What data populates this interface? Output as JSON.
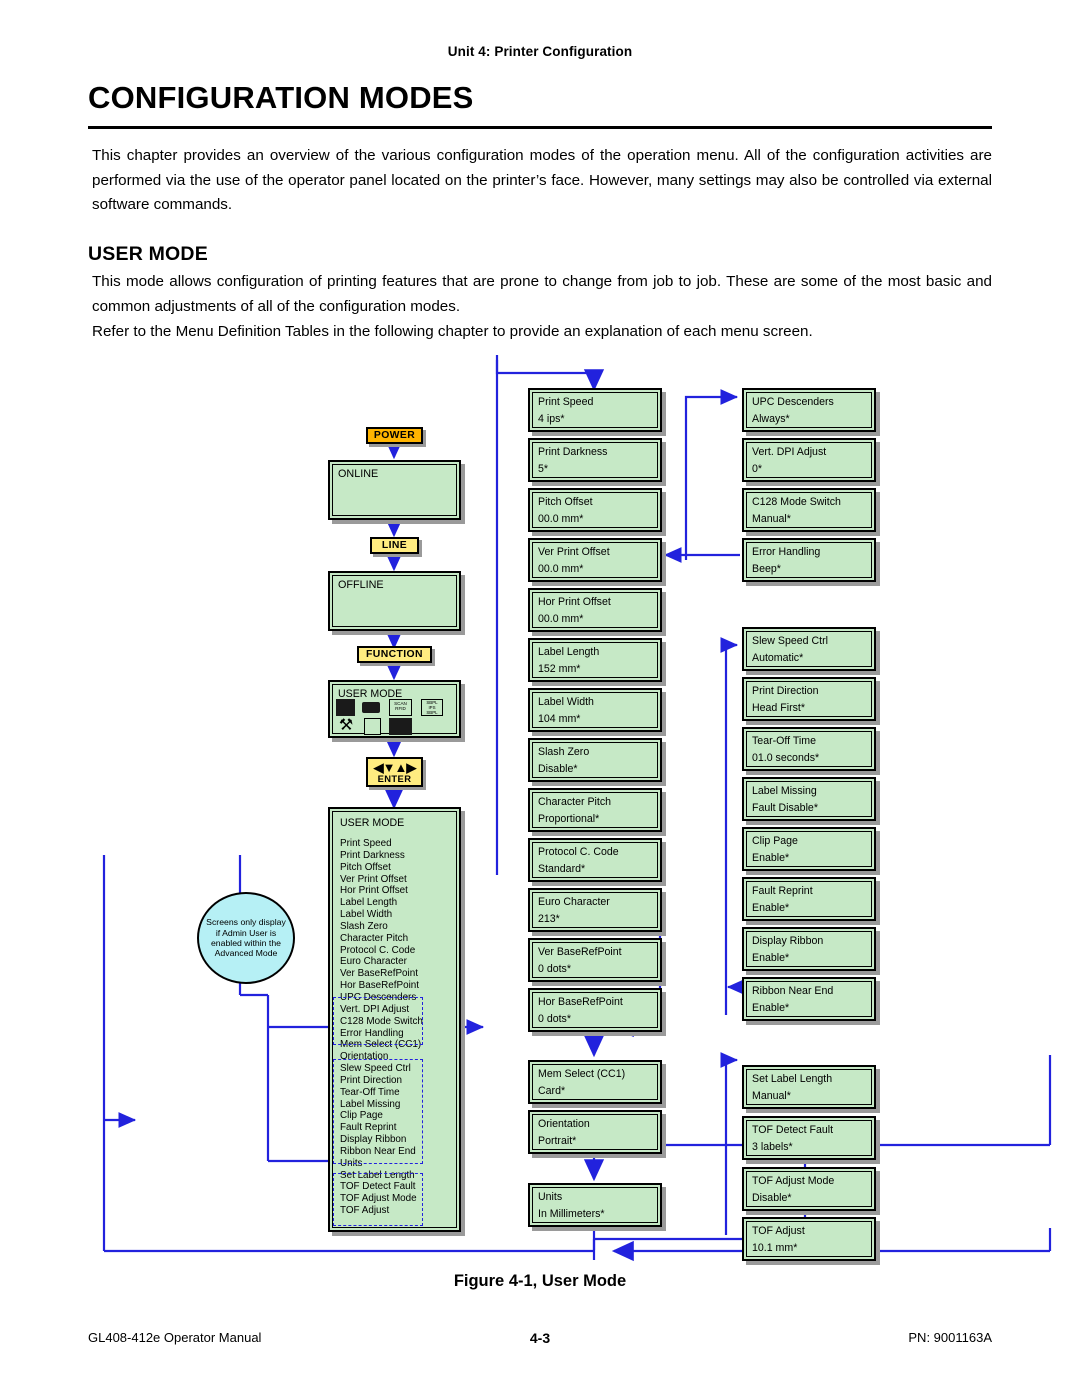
{
  "header": {
    "running_head": "Unit 4:  Printer Configuration",
    "title": "CONFIGURATION MODES"
  },
  "body": {
    "intro": "This chapter provides an overview of the various configuration modes of the operation menu. All of the configuration activities are performed via the use of the operator panel located on the printer’s face. However, many settings may also be controlled via external software commands.",
    "user_mode_heading": "USER MODE",
    "user_mode_para": "This mode allows configuration of printing features that are prone to change from job to job. These are some of the most basic and common adjustments of all of the configuration modes.",
    "refer_para": "Refer to the Menu Definition Tables in the following chapter to provide an explanation of each menu screen."
  },
  "figure": {
    "caption": "Figure 4-1, User Mode",
    "keys": {
      "power": "POWER",
      "line": "LINE",
      "function": "FUNCTION",
      "enter_glyphs": "◀▼▲▶",
      "enter_label": "ENTER"
    },
    "panels": {
      "online": "ONLINE",
      "offline": "OFFLINE",
      "user_mode_icons_title": "USER MODE",
      "icon_labels": {
        "scan": "SCAN",
        "rfid": "RFID",
        "sbpl_top": "SBPL",
        "sbpl_mid": "IPS",
        "sbpl_bot": "SBPL"
      }
    },
    "callout": "Screens only display if Admin User is enabled within the Advanced Mode",
    "menu_list": {
      "title": "USER MODE",
      "items": [
        "Print Speed",
        "Print Darkness",
        "Pitch Offset",
        "Ver Print Offset",
        "Hor Print Offset",
        "Label Length",
        "Label Width",
        "Slash Zero",
        "Character Pitch",
        "Protocol C. Code",
        "Euro Character",
        "Ver BaseRefPoint",
        "Hor BaseRefPoint",
        "UPC Descenders",
        "Vert. DPI Adjust",
        "C128 Mode Switch",
        "Error Handling",
        "Mem Select (CC1)",
        "Orientation",
        "Slew Speed Ctrl",
        "Print Direction",
        "Tear-Off Time",
        "Label Missing",
        "Clip Page",
        "Fault Reprint",
        "Display Ribbon",
        "Ribbon Near End",
        "Units",
        "Set Label Length",
        "TOF Detect Fault",
        "TOF Adjust Mode",
        "TOF Adjust"
      ]
    },
    "column_middle_a": [
      {
        "name": "Print Speed",
        "value": "4 ips*"
      },
      {
        "name": "Print Darkness",
        "value": "5*"
      },
      {
        "name": "Pitch Offset",
        "value": "00.0 mm*"
      },
      {
        "name": "Ver Print Offset",
        "value": "00.0 mm*"
      },
      {
        "name": "Hor Print Offset",
        "value": "00.0 mm*"
      },
      {
        "name": "Label Length",
        "value": "152 mm*"
      },
      {
        "name": "Label Width",
        "value": "104 mm*"
      },
      {
        "name": "Slash Zero",
        "value": "Disable*"
      },
      {
        "name": "Character Pitch",
        "value": "Proportional*"
      },
      {
        "name": "Protocol C. Code",
        "value": "Standard*"
      },
      {
        "name": "Euro Character",
        "value": "213*"
      },
      {
        "name": "Ver BaseRefPoint",
        "value": "0 dots*"
      },
      {
        "name": "Hor BaseRefPoint",
        "value": "0 dots*"
      }
    ],
    "column_middle_b": [
      {
        "name": "Mem Select (CC1)",
        "value": "Card*"
      },
      {
        "name": "Orientation",
        "value": "Portrait*"
      }
    ],
    "column_middle_c": [
      {
        "name": "Units",
        "value": "In Millimeters*"
      }
    ],
    "column_right_a": [
      {
        "name": "UPC Descenders",
        "value": "Always*"
      },
      {
        "name": "Vert. DPI Adjust",
        "value": "0*"
      },
      {
        "name": "C128 Mode Switch",
        "value": "Manual*"
      },
      {
        "name": "Error Handling",
        "value": "Beep*"
      }
    ],
    "column_right_b": [
      {
        "name": "Slew Speed Ctrl",
        "value": "Automatic*"
      },
      {
        "name": "Print Direction",
        "value": "Head First*"
      },
      {
        "name": "Tear-Off Time",
        "value": "01.0  seconds*"
      },
      {
        "name": "Label Missing",
        "value": "Fault Disable*"
      },
      {
        "name": "Clip Page",
        "value": "Enable*"
      },
      {
        "name": "Fault Reprint",
        "value": "Enable*"
      },
      {
        "name": "Display Ribbon",
        "value": "Enable*"
      },
      {
        "name": "Ribbon Near End",
        "value": "Enable*"
      }
    ],
    "column_right_c": [
      {
        "name": "Set Label Length",
        "value": "Manual*"
      },
      {
        "name": "TOF Detect Fault",
        "value": "3 labels*"
      },
      {
        "name": "TOF Adjust Mode",
        "value": "Disable*"
      },
      {
        "name": "TOF Adjust",
        "value": "10.1  mm*"
      }
    ]
  },
  "footer": {
    "left": "GL408-412e Operator Manual",
    "center": "4-3",
    "right": "PN: 9001163A"
  },
  "colors": {
    "screen_green": "#c6e9c6",
    "key_power": "#ffb400",
    "key_yellow": "#ffec80",
    "callout_cyan": "#b6f0f5",
    "wire_blue": "#2222dd"
  }
}
